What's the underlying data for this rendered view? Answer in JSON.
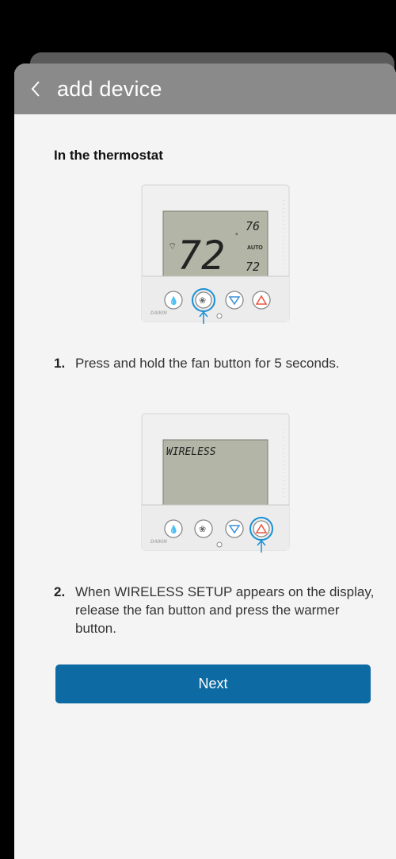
{
  "header": {
    "title": "add device"
  },
  "section": {
    "heading": "In the thermostat"
  },
  "thermostat1": {
    "temp_main": "72",
    "temp_set_high": "76",
    "temp_set_low": "72",
    "mode": "AUTO",
    "brand": "DAIKIN",
    "highlighted_button": "fan-button"
  },
  "steps": [
    {
      "number": "1.",
      "text": "Press and hold the fan button for 5 seconds."
    },
    {
      "number": "2.",
      "text": "When WIRELESS SETUP appears on the display, release the fan button and press the warmer button."
    }
  ],
  "thermostat2": {
    "display_text": "WIRELESS",
    "brand": "DAIKIN",
    "highlighted_button": "warmer-button"
  },
  "colors": {
    "accent": "#0e6aa3",
    "highlight": "#1a8fd6",
    "cooler": "#3a8fd8",
    "warmer": "#e8553c",
    "lcd": "#b3b5a6"
  },
  "button": {
    "next_label": "Next"
  }
}
